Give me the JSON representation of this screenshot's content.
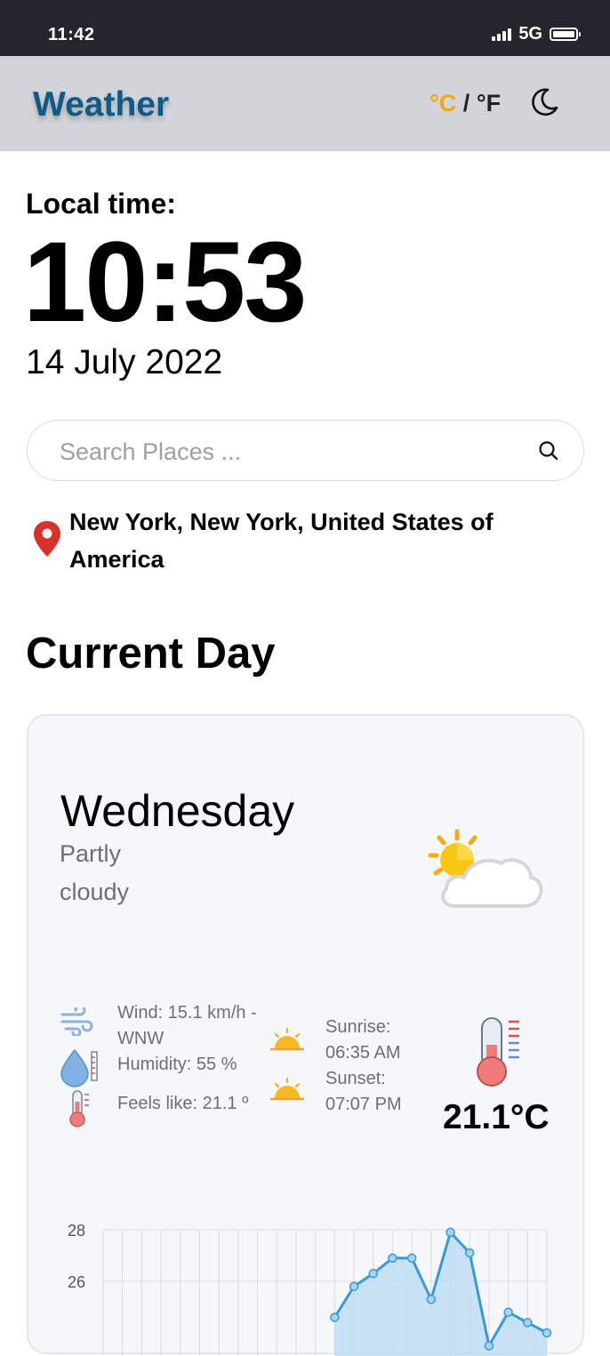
{
  "status_bar": {
    "time": "11:42",
    "network": "5G"
  },
  "header": {
    "brand": "Weather",
    "unit_celsius": "°C",
    "unit_separator": " / ",
    "unit_fahrenheit": "°F",
    "theme_icon": "moon-icon"
  },
  "local_time": {
    "label": "Local time:",
    "clock": "10:53",
    "date": "14 July 2022"
  },
  "search": {
    "placeholder": "Search Places ...",
    "icon": "search-icon"
  },
  "location": {
    "icon": "map-pin-icon",
    "text": "New York, New York, United States of America"
  },
  "section_title": "Current Day",
  "current": {
    "day": "Wednesday",
    "condition": "Partly cloudy",
    "condition_icon": "partly-cloudy-icon",
    "wind": "Wind: 15.1 km/h - WNW",
    "humidity": "Humidity: 55 %",
    "feels_like": "Feels like: 21.1 º",
    "sunrise": "Sunrise: 06:35 AM",
    "sunset": "Sunset: 07:07 PM",
    "temperature": "21.1°C"
  },
  "colors": {
    "brand": "#0e5a86",
    "unit_active": "#f3a712",
    "chart_line": "#3a9ad9",
    "chart_fill": "#bcdcf3"
  },
  "chart_data": {
    "type": "area",
    "yticks": [
      "28",
      "26"
    ],
    "ylim": [
      22,
      28.5
    ],
    "grid": true,
    "x": [
      0,
      1,
      2,
      3,
      4,
      5,
      6,
      7,
      8,
      9,
      10,
      11,
      12,
      13,
      14,
      15,
      16,
      17,
      18,
      19,
      20,
      21,
      22,
      23
    ],
    "values": [
      null,
      null,
      null,
      null,
      null,
      null,
      null,
      null,
      null,
      null,
      null,
      null,
      24.6,
      25.8,
      26.3,
      26.9,
      26.9,
      25.3,
      27.9,
      27.1,
      23.5,
      24.8,
      24.4,
      24.0
    ]
  }
}
